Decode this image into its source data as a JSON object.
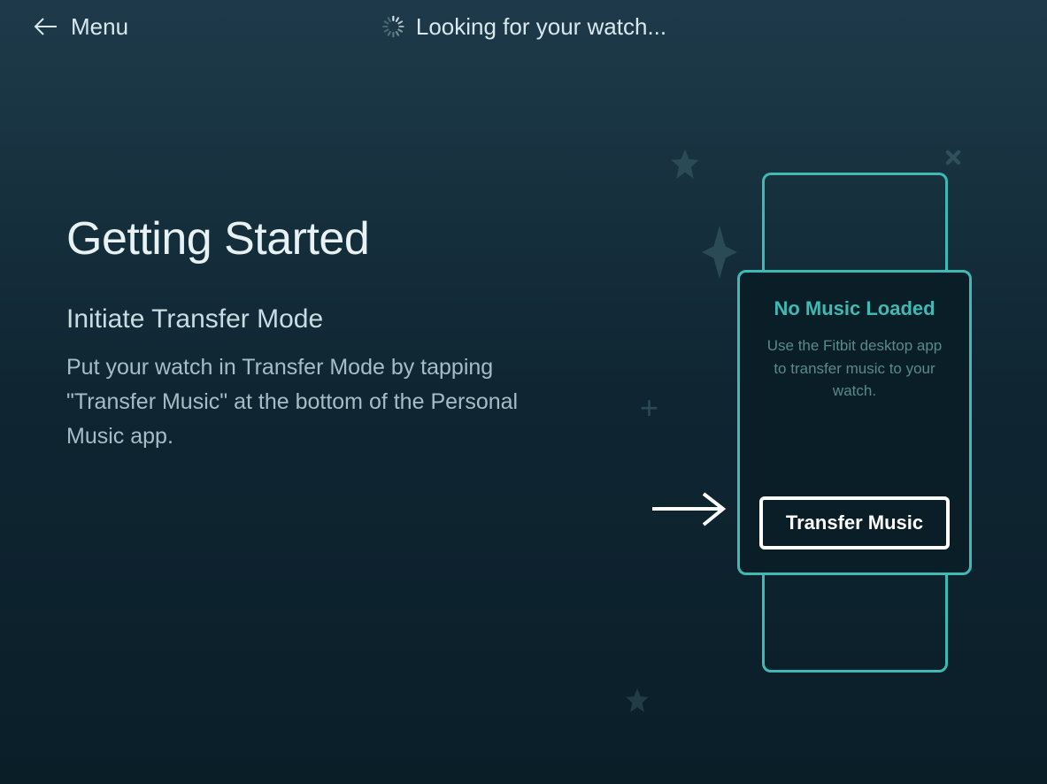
{
  "header": {
    "menu_label": "Menu",
    "status_text": "Looking for your watch..."
  },
  "content": {
    "title": "Getting Started",
    "subtitle": "Initiate Transfer Mode",
    "description": "Put your watch in Transfer Mode by tapping \"Transfer Music\" at the bottom of the Personal Music app."
  },
  "watch": {
    "title": "No Music Loaded",
    "description": "Use the Fitbit desktop app to transfer music to your watch.",
    "button_label": "Transfer Music"
  }
}
